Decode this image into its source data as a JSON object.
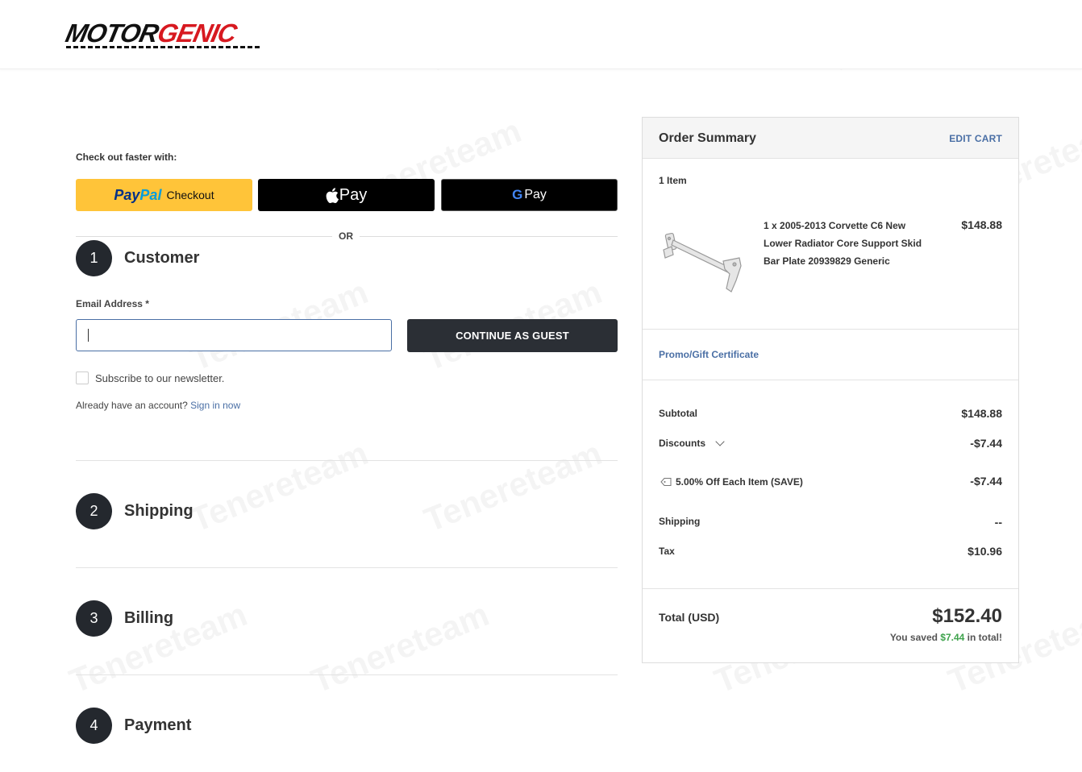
{
  "brand": {
    "part1": "MOTOR",
    "part2": "GENIC"
  },
  "checkout": {
    "faster_label": "Check out faster with:",
    "paypal": {
      "word1": "Pay",
      "word2": "Pal",
      "word3": "Checkout"
    },
    "apple_pay": {
      "label": "Pay"
    },
    "google_pay": {
      "g": "G",
      "label": "Pay"
    },
    "or_label": "OR"
  },
  "steps": [
    {
      "number": "1",
      "title": "Customer"
    },
    {
      "number": "2",
      "title": "Shipping"
    },
    {
      "number": "3",
      "title": "Billing"
    },
    {
      "number": "4",
      "title": "Payment"
    }
  ],
  "customer": {
    "email_label": "Email Address *",
    "email_value": "",
    "continue_label": "CONTINUE AS GUEST",
    "newsletter_label": "Subscribe to our newsletter.",
    "account_text": "Already have an account?",
    "sign_in_label": "Sign in now"
  },
  "summary": {
    "title": "Order Summary",
    "edit_cart": "EDIT CART",
    "items_count": "1 Item",
    "product_name": "1 x 2005-2013 Corvette C6 New Lower Radiator Core Support Skid Bar Plate 20939829 Generic",
    "product_price": "$148.88",
    "promo_label": "Promo/Gift Certificate",
    "subtotal_label": "Subtotal",
    "subtotal_value": "$148.88",
    "discounts_label": "Discounts",
    "discounts_value": "-$7.44",
    "discount_item_label": "5.00% Off Each Item (SAVE)",
    "discount_item_value": "-$7.44",
    "shipping_label": "Shipping",
    "shipping_value": "--",
    "tax_label": "Tax",
    "tax_value": "$10.96",
    "total_label": "Total (USD)",
    "total_value": "$152.40",
    "saved_prefix": "You saved",
    "saved_amount": "$7.44",
    "saved_suffix": "in total!"
  },
  "watermark": "Tenereteam",
  "colors": {
    "brand_red": "#d71920",
    "paypal_yellow": "#ffc439",
    "link_blue": "#4a6fa5",
    "dark_button": "#2b2f35",
    "saved_green": "#3fa34d"
  }
}
